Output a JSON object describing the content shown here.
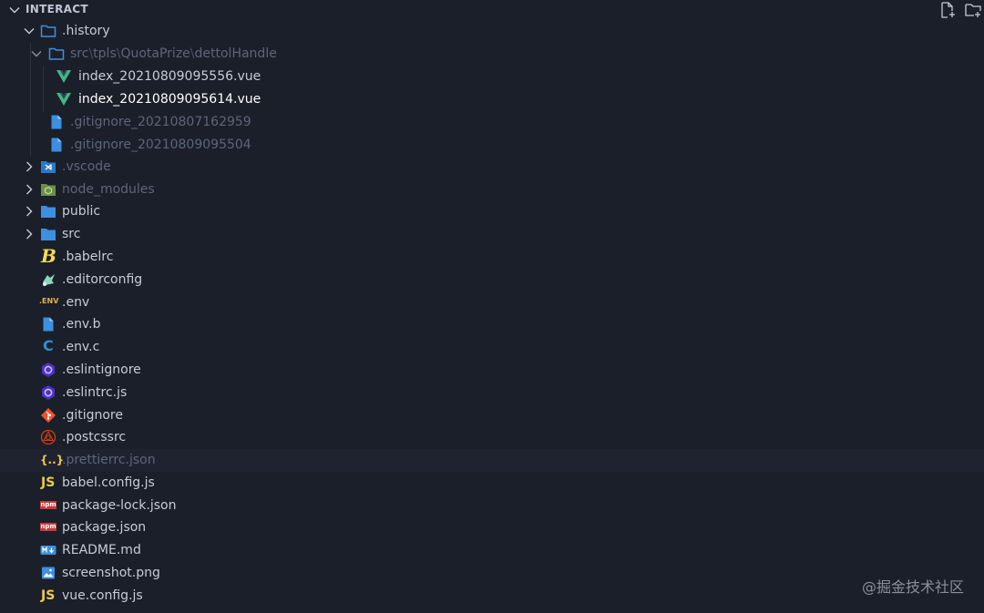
{
  "explorer": {
    "section_title": "INTERACT",
    "actions": [
      "new-file-icon",
      "new-folder-icon"
    ]
  },
  "tree": {
    "history": ".history",
    "history_path": {
      "seg1": "src",
      "seg2": "tpls",
      "seg3": "QuotaPrize",
      "seg4": "dettolHandle",
      "separator": "\\"
    },
    "vue_file_1": "index_20210809095556.vue",
    "vue_file_2": "index_20210809095614.vue",
    "gitignore_1": ".gitignore_20210807162959",
    "gitignore_2": ".gitignore_20210809095504",
    "vscode": ".vscode",
    "node_modules": "node_modules",
    "public": "public",
    "src": "src",
    "babelrc": ".babelrc",
    "editorconfig": ".editorconfig",
    "env": ".env",
    "env_b": ".env.b",
    "env_c": ".env.c",
    "eslintignore": ".eslintignore",
    "eslintrc": ".eslintrc.js",
    "gitignore": ".gitignore",
    "postcssrc": ".postcssrc",
    "prettierrc": ".prettierrc.json",
    "babel_config": "babel.config.js",
    "package_lock": "package-lock.json",
    "package_json": "package.json",
    "readme": "README.md",
    "screenshot": "screenshot.png",
    "vue_config": "vue.config.js"
  },
  "icon_text": {
    "env_badge": ".ENV",
    "js_badge": "JS",
    "npm_badge": "npm",
    "c_badge": "C",
    "b_badge": "B",
    "json_badge": "{..}"
  },
  "watermark": "@掘金技术社区",
  "colors": {
    "background": "#1b1f2a",
    "folder": "#3d8fe0",
    "vue": "#41b883",
    "js": "#f0c94a",
    "npm": "#cb3837",
    "git": "#f05133",
    "eslint": "#7a5cf0"
  }
}
